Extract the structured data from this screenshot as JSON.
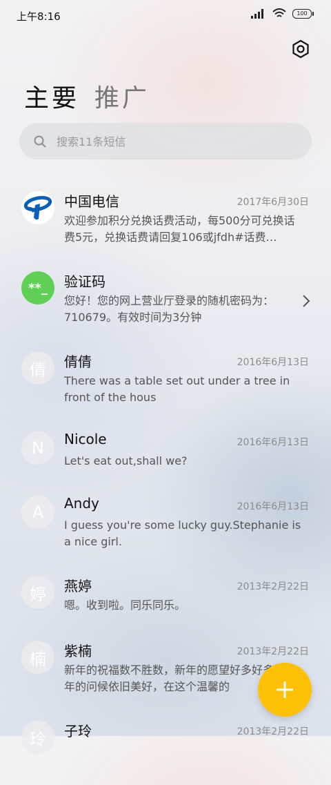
{
  "status_bar": {
    "time": "上午8:16",
    "battery": "100"
  },
  "tabs": [
    {
      "label": "主要"
    },
    {
      "label": "推广"
    }
  ],
  "search": {
    "placeholder": "搜索11条短信"
  },
  "messages": [
    {
      "sender": "中国电信",
      "date": "2017年6月30日",
      "preview": "欢迎参加积分兑换话费活动，每500分可兑换话费5元，兑换话费请回复106或jfdh#话费…",
      "avatar": "telecom-logo"
    },
    {
      "sender": "验证码",
      "date": "",
      "preview": "您好！您的网上营业厅登录的随机密码为：710679。有效时间为3分钟",
      "avatar_text": "**_"
    },
    {
      "sender": "倩倩",
      "date": "2016年6月13日",
      "preview": "There was a table set out under a tree in front of the hous",
      "avatar_text": "倩"
    },
    {
      "sender": "Nicole",
      "date": "2016年6月13日",
      "preview": "Let's eat out,shall we?",
      "avatar_text": "N"
    },
    {
      "sender": "Andy",
      "date": "2016年6月13日",
      "preview": "I guess you're some lucky guy.Stephanie is a nice girl.",
      "avatar_text": "A"
    },
    {
      "sender": "燕婷",
      "date": "2013年2月22日",
      "preview": "嗯。收到啦。同乐同乐。",
      "avatar_text": "婷"
    },
    {
      "sender": "紫楠",
      "date": "2013年2月22日",
      "preview": "新年的祝福数不胜数，新年的愿望好多好多，新年的问候依旧美好，在这个温馨的",
      "avatar_text": "楠"
    },
    {
      "sender": "子玲",
      "date": "2013年2月22日",
      "preview": "",
      "avatar_text": "玲"
    }
  ],
  "colors": {
    "accent_fab": "#ffc107",
    "captcha_avatar": "#5fcf55",
    "telecom_blue": "#0b5fb6"
  }
}
